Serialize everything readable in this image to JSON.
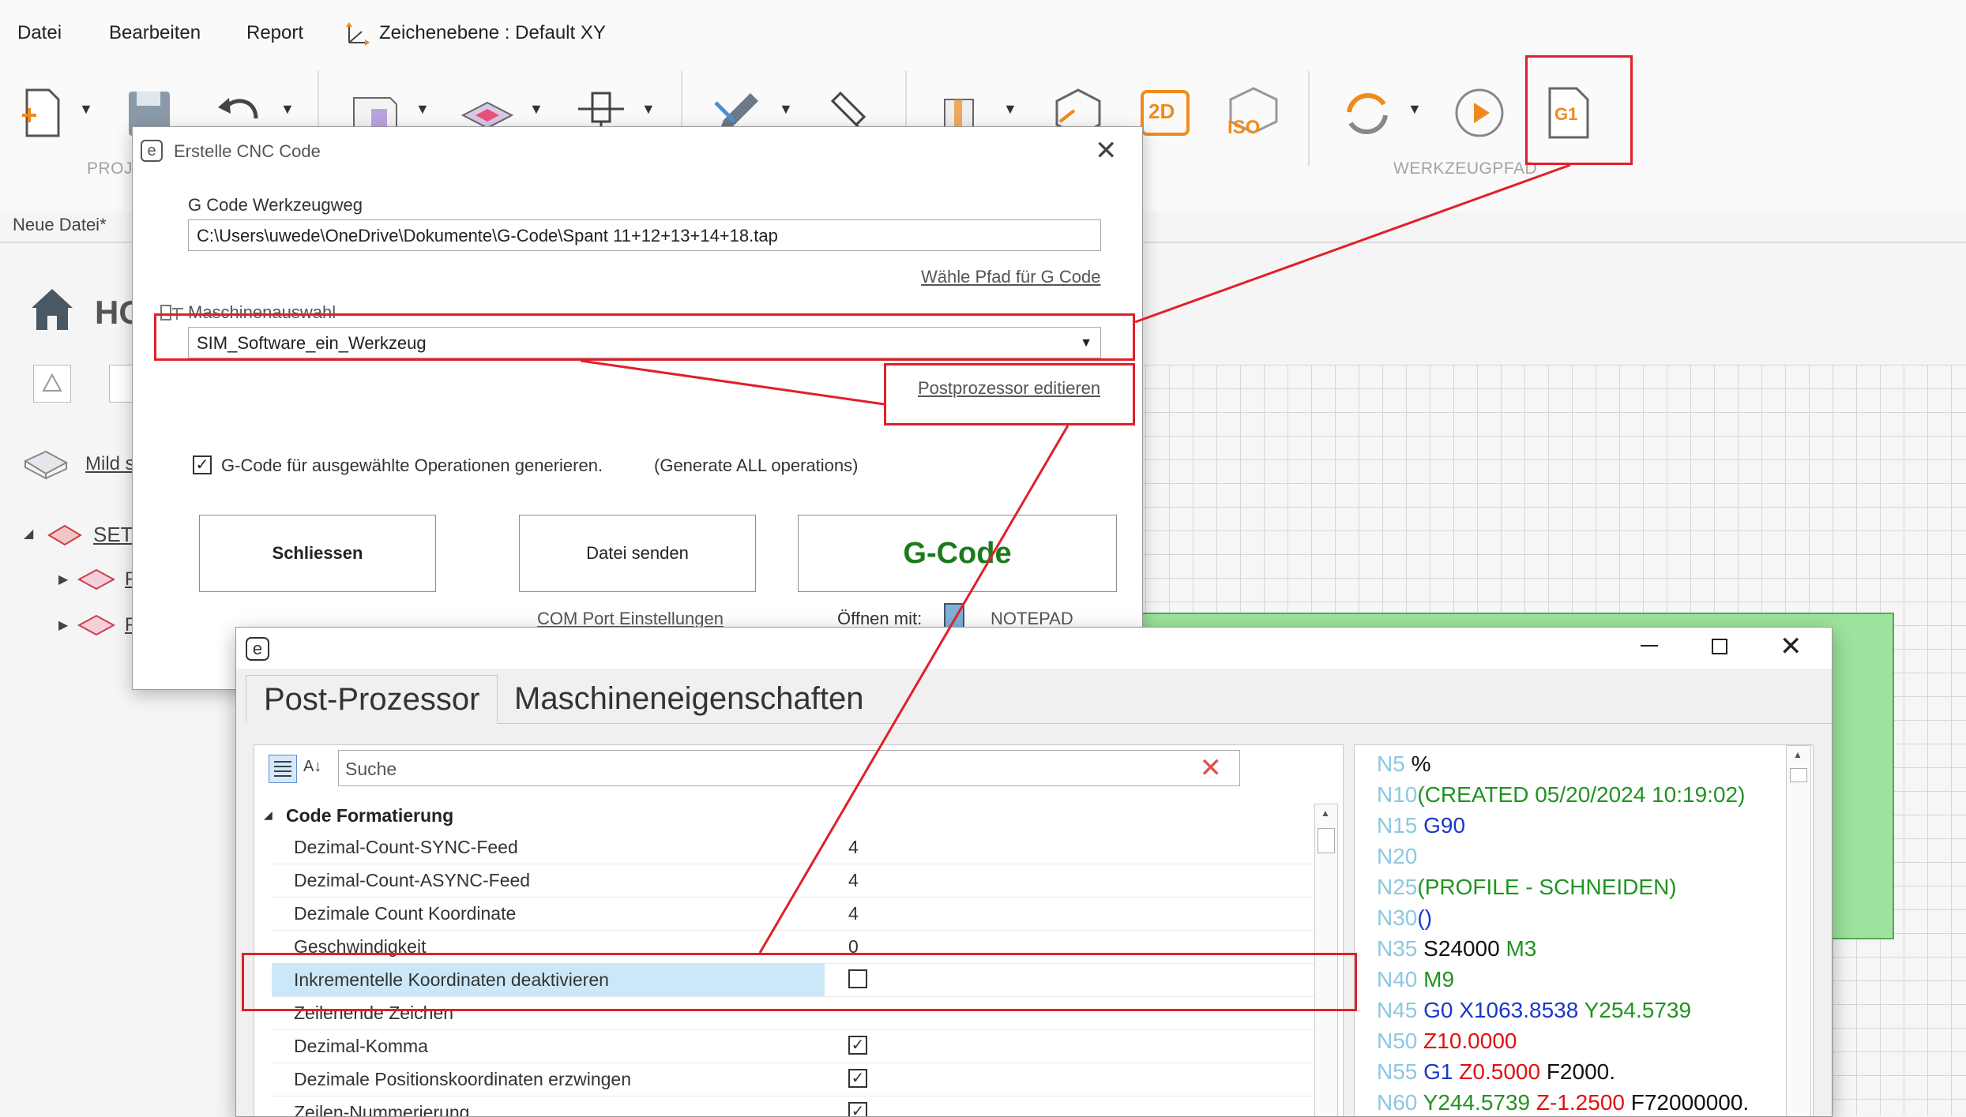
{
  "menu": {
    "datei": "Datei",
    "bearbeiten": "Bearbeiten",
    "report": "Report",
    "zeichenebene": "Zeichenebene : Default XY"
  },
  "ribbon": {
    "group_proj": "PROJ",
    "group_werkzeugpfad": "WERKZEUGPFAD",
    "label_2d": "2D",
    "label_iso": "ISO",
    "label_g1": "G1"
  },
  "file_tab": "Neue Datei*",
  "tree": {
    "home_title": "HO",
    "mild_label": "Mild s",
    "setup_label": "SET",
    "child1": "P",
    "child2": "P"
  },
  "cnc_dialog": {
    "title": "Erstelle CNC Code",
    "gcode_label": "G Code Werkzeugweg",
    "gcode_path": "C:\\Users\\uwede\\OneDrive\\Dokumente\\G-Code\\Spant 11+12+13+14+18.tap",
    "choose_path_link": "Wähle Pfad für G Code",
    "machine_label": "Maschinenauswahl",
    "machine_value": "SIM_Software_ein_Werkzeug",
    "edit_postprocessor_link": "Postprozessor editieren",
    "generate_selected_label": "G-Code für ausgewählte Operationen generieren.",
    "generate_all_label": "(Generate ALL operations)",
    "close_button": "Schliessen",
    "send_button": "Datei senden",
    "gcode_button": "G-Code",
    "com_port_link": "COM Port Einstellungen",
    "open_with_label": "Öffnen mit:",
    "notepad_label": "NOTEPAD"
  },
  "post_window": {
    "tabs": [
      "Post-Prozessor",
      "Maschineneigenschaften"
    ],
    "search_placeholder": "Suche",
    "category": "Code Formatierung",
    "properties": [
      {
        "name": "Dezimal-Count-SYNC-Feed",
        "value": "4"
      },
      {
        "name": "Dezimal-Count-ASYNC-Feed",
        "value": "4"
      },
      {
        "name": "Dezimale Count Koordinate",
        "value": "4"
      },
      {
        "name": "Geschwindigkeit",
        "value": "0"
      },
      {
        "name": "Inkrementelle Koordinaten deaktivieren",
        "value": "unchecked"
      },
      {
        "name": "Zeilenende Zeichen",
        "value": ""
      },
      {
        "name": "Dezimal-Komma",
        "value": "checked"
      },
      {
        "name": "Dezimale Positionskoordinaten erzwingen",
        "value": "checked"
      },
      {
        "name": "Zeilen-Nummerierung",
        "value": "checked"
      }
    ],
    "code_lines": [
      [
        [
          "N5 ",
          "cg"
        ],
        [
          "%",
          "cb"
        ]
      ],
      [
        [
          "N10",
          "cg"
        ],
        [
          "(CREATED 05/20/2024 10:19:02)",
          "cgr"
        ]
      ],
      [
        [
          "N15 ",
          "cg"
        ],
        [
          "G90",
          "cu"
        ]
      ],
      [
        [
          "N20",
          "cg"
        ]
      ],
      [
        [
          "N25",
          "cg"
        ],
        [
          "(PROFILE - SCHNEIDEN)",
          "cgr"
        ]
      ],
      [
        [
          "N30",
          "cg"
        ],
        [
          "()",
          "cu"
        ]
      ],
      [
        [
          "N35 ",
          "cg"
        ],
        [
          "S24000 ",
          "cb"
        ],
        [
          "M3",
          "cgr"
        ]
      ],
      [
        [
          "N40 ",
          "cg"
        ],
        [
          "M9",
          "cgr"
        ]
      ],
      [
        [
          "N45 ",
          "cg"
        ],
        [
          "G0 X1063.8538 ",
          "cu"
        ],
        [
          "Y254.5739",
          "cgr"
        ]
      ],
      [
        [
          "N50 ",
          "cg"
        ],
        [
          "Z10.0000",
          "cr"
        ]
      ],
      [
        [
          "N55 ",
          "cg"
        ],
        [
          "G1 ",
          "cu"
        ],
        [
          "Z0.5000 ",
          "cr"
        ],
        [
          "F2000.",
          "cb"
        ]
      ],
      [
        [
          "N60 ",
          "cg"
        ],
        [
          "Y244.5739 ",
          "cgr"
        ],
        [
          "Z-1.2500 ",
          "cr"
        ],
        [
          "F72000000.",
          "cb"
        ]
      ]
    ]
  },
  "colors": {
    "highlight_red": "#e0202a",
    "gcode_green": "#1c7a1c",
    "selected_row": "#cce8f8",
    "icon_orange": "#f08a1c"
  }
}
